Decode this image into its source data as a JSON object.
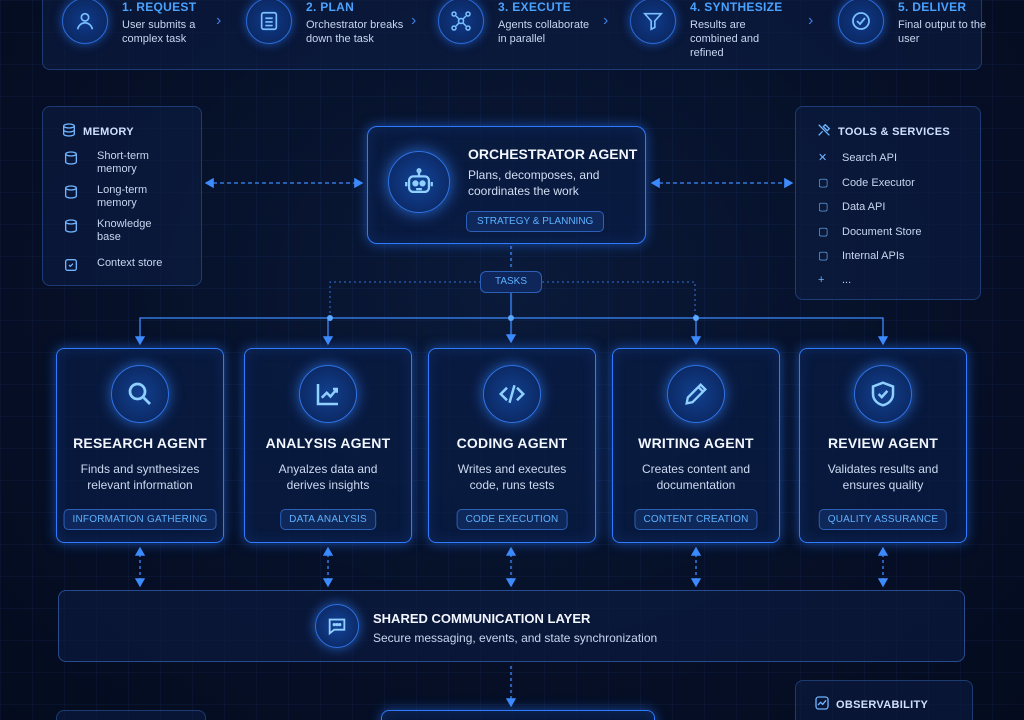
{
  "steps": [
    {
      "title": "1. REQUEST",
      "desc": "User submits a complex task",
      "icon": "user-icon"
    },
    {
      "title": "2. PLAN",
      "desc": "Orchestrator breaks down the task",
      "icon": "list-icon"
    },
    {
      "title": "3. EXECUTE",
      "desc": "Agents collaborate in parallel",
      "icon": "network-icon"
    },
    {
      "title": "4. SYNTHESIZE",
      "desc": "Results are combined and refined",
      "icon": "filter-icon"
    },
    {
      "title": "5. DELIVER",
      "desc": "Final output to the user",
      "icon": "check-circle-icon"
    }
  ],
  "memory": {
    "title": "MEMORY",
    "items": [
      "Short-term memory",
      "Long-term memory",
      "Knowledge base",
      "Context store"
    ]
  },
  "tools": {
    "title": "TOOLS & SERVICES",
    "items": [
      "Search API",
      "Code Executor",
      "Data API",
      "Document Store",
      "Internal APIs",
      "..."
    ]
  },
  "orchestrator": {
    "title": "ORCHESTRATOR AGENT",
    "desc": "Plans, decomposes, and coordinates the work",
    "badge": "STRATEGY & PLANNING",
    "icon": "robot-icon"
  },
  "tasks_label": "TASKS",
  "agents": [
    {
      "title": "RESEARCH AGENT",
      "desc1": "Finds and synthesizes",
      "desc2": "relevant information",
      "badge": "INFORMATION GATHERING",
      "icon": "magnifier-icon"
    },
    {
      "title": "ANALYSIS AGENT",
      "desc1": "Anyalzes data and",
      "desc2": "derives insights",
      "badge": "DATA ANALYSIS",
      "icon": "chart-icon"
    },
    {
      "title": "CODING AGENT",
      "desc1": "Writes and executes",
      "desc2": "code, runs tests",
      "badge": "CODE EXECUTION",
      "icon": "code-icon"
    },
    {
      "title": "WRITING AGENT",
      "desc1": "Creates content and",
      "desc2": "documentation",
      "badge": "CONTENT CREATION",
      "icon": "pencil-icon"
    },
    {
      "title": "REVIEW AGENT",
      "desc1": "Validates results and",
      "desc2": "ensures quality",
      "badge": "QUALITY ASSURANCE",
      "icon": "shield-check-icon"
    }
  ],
  "shared": {
    "title": "SHARED COMMUNICATION LAYER",
    "desc": "Secure messaging, events, and state synchronization",
    "icon": "chat-icon"
  },
  "observability": {
    "title": "OBSERVABILITY",
    "icon": "pulse-icon"
  },
  "colors": {
    "accent": "#2f7bff",
    "heading": "#4aa2ff",
    "background": "#061028"
  }
}
